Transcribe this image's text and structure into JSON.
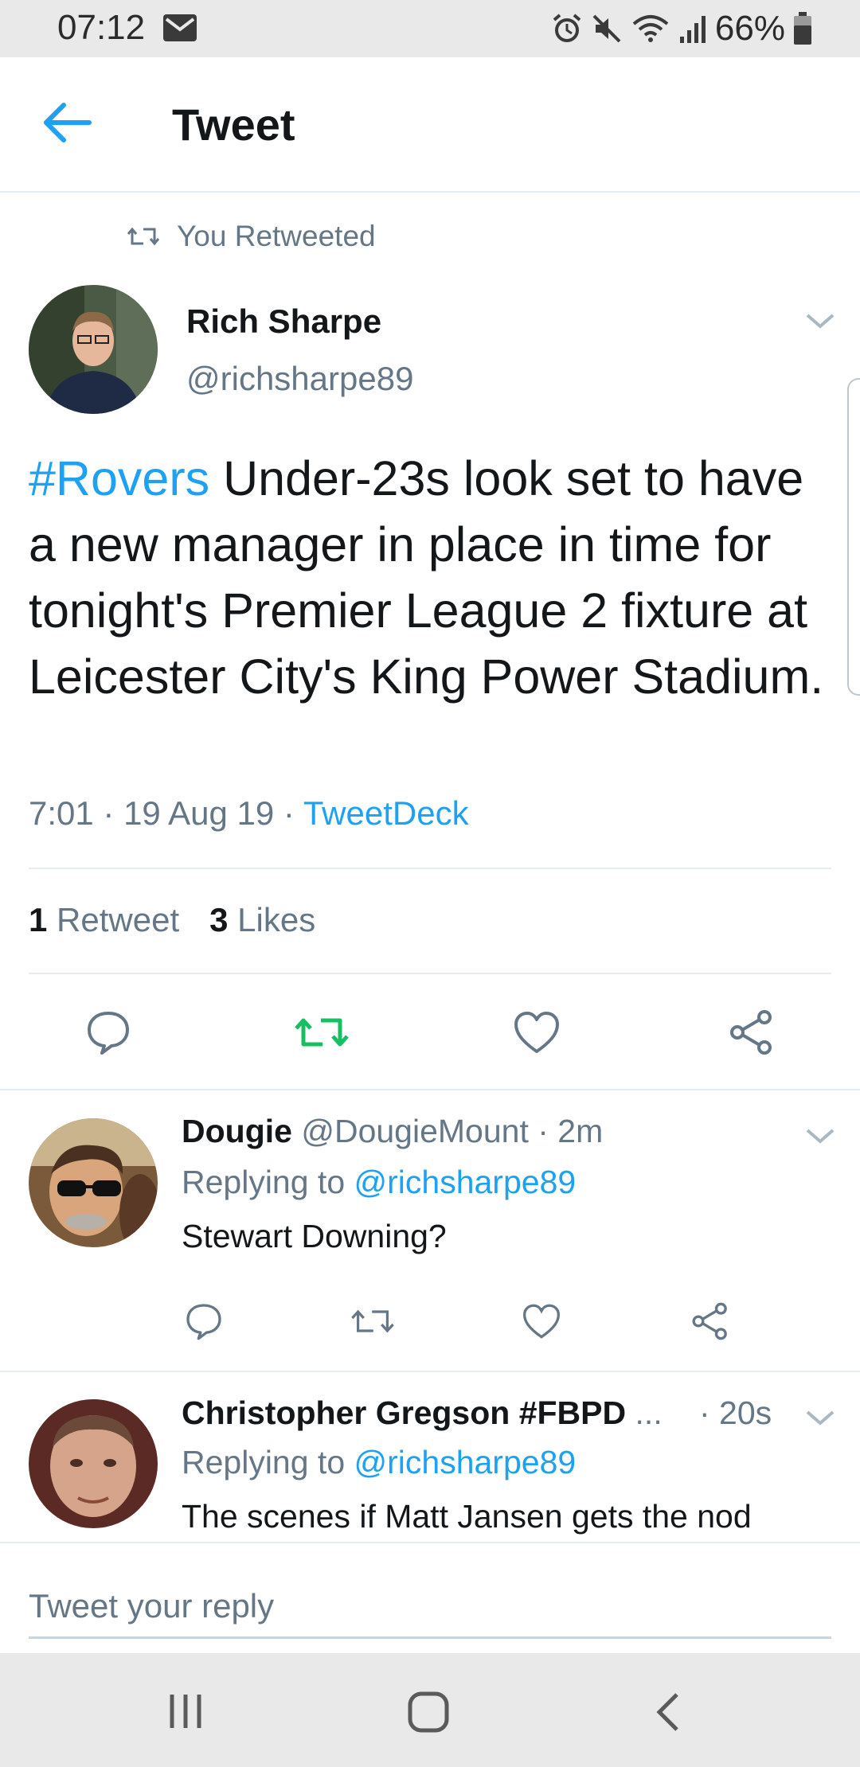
{
  "status_bar": {
    "time": "07:12",
    "battery": "66%",
    "icons": [
      "mail-icon",
      "alarm-icon",
      "mute-icon",
      "wifi-icon",
      "signal-icon",
      "battery-icon"
    ]
  },
  "header": {
    "title": "Tweet",
    "back_icon": "arrow-left-icon"
  },
  "tweet": {
    "retweet_note": "You Retweeted",
    "author_name": "Rich Sharpe",
    "author_handle": "@richsharpe89",
    "hashtag": "#Rovers",
    "text": " Under-23s look set to have a new manager in place in time for tonight's Premier League 2 fixture at Leicester City's King Power Stadium.",
    "time": "7:01 · 19 Aug 19 · ",
    "source": "TweetDeck",
    "retweet_count": "1",
    "retweet_label": "Retweet",
    "like_count": "3",
    "like_label": "Likes",
    "accent_color": "#1da1f2",
    "retweeted_color": "#17bf63"
  },
  "replies": [
    {
      "name": "Dougie",
      "handle": "@DougieMount",
      "time": "· 2m",
      "replying_prefix": "Replying to ",
      "replying_to": "@richsharpe89",
      "text": "Stewart Downing?"
    },
    {
      "name": "Christopher Gregson #FBPD",
      "ellipsis": "...",
      "time": "· 20s",
      "replying_prefix": "Replying to ",
      "replying_to": "@richsharpe89",
      "text": "The scenes if Matt Jansen gets the nod"
    }
  ],
  "composer": {
    "placeholder": "Tweet your reply"
  },
  "nav": {
    "icons": [
      "recent-apps-icon",
      "home-icon",
      "back-icon"
    ]
  }
}
